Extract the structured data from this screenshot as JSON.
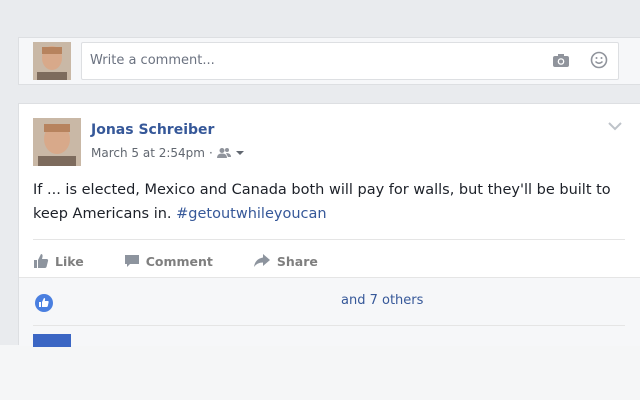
{
  "composer": {
    "placeholder": "Write a comment..."
  },
  "post": {
    "author": "Jonas Schreiber",
    "timestamp": "March 5 at 2:54pm",
    "separator": "·",
    "text_before": "If ... is elected, Mexico and Canada both will pay for walls, but they'll be built to keep Americans in. ",
    "hashtag": "#getoutwhileyoucan"
  },
  "actions": {
    "like": "Like",
    "comment": "Comment",
    "share": "Share"
  },
  "reactions": {
    "summary": "and 7 others"
  },
  "colors": {
    "link": "#365899",
    "like_badge": "#4267b2"
  },
  "icons": [
    "camera-icon",
    "smiley-icon",
    "friends-icon",
    "dropdown-caret-icon",
    "chevron-down-icon",
    "thumbs-up-icon",
    "comment-icon",
    "share-icon",
    "like-reaction-icon"
  ]
}
